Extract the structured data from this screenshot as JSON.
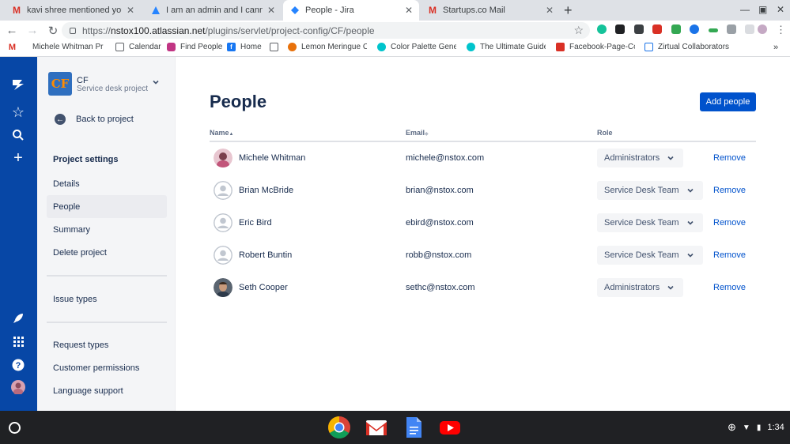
{
  "browser": {
    "tabs": [
      {
        "title": "kavi shree mentioned you in I am",
        "icon": "gmail-icon",
        "active": false
      },
      {
        "title": "I am an admin and I cannot ass",
        "icon": "atlassian-icon",
        "active": false
      },
      {
        "title": "People - Jira",
        "icon": "jira-icon",
        "active": true
      },
      {
        "title": "Startups.co Mail",
        "icon": "gmail-icon",
        "active": false
      }
    ],
    "new_tab": "+",
    "url_scheme": "https://",
    "url_host": "nstox100.atlassian.net",
    "url_path": "/plugins/servlet/project-config/CF/people",
    "bookmarks": [
      {
        "label": "Michele Whitman Pr",
        "icon": "gmail-icon"
      },
      {
        "label": "Calendar",
        "icon": "page-icon"
      },
      {
        "label": "Find People",
        "icon": "instagram-icon"
      },
      {
        "label": "Home",
        "icon": "facebook-icon"
      },
      {
        "label": "",
        "icon": "page-icon"
      },
      {
        "label": "Lemon Meringue Ch",
        "icon": "recipe-icon"
      },
      {
        "label": "Color Palette Genera",
        "icon": "canva-icon"
      },
      {
        "label": "The Ultimate Guide t",
        "icon": "canva-icon"
      },
      {
        "label": "Facebook-Page-Cove",
        "icon": "image-icon"
      },
      {
        "label": "Zirtual Collaborators",
        "icon": "grid-icon"
      }
    ],
    "more_bookmarks": "»"
  },
  "project": {
    "name": "CF",
    "type": "Service desk project",
    "avatar_text": "CF"
  },
  "sidebar": {
    "back_label": "Back to project",
    "section_title": "Project settings",
    "items": [
      {
        "label": "Details",
        "active": false
      },
      {
        "label": "People",
        "active": true
      },
      {
        "label": "Summary",
        "active": false
      },
      {
        "label": "Delete project",
        "active": false
      }
    ],
    "group2": [
      {
        "label": "Issue types"
      }
    ],
    "group3": [
      {
        "label": "Request types"
      },
      {
        "label": "Customer permissions"
      },
      {
        "label": "Language support"
      }
    ]
  },
  "page": {
    "title": "People",
    "add_button": "Add people",
    "columns": {
      "name": "Name",
      "email": "Email",
      "role": "Role"
    },
    "remove_label": "Remove",
    "people": [
      {
        "name": "Michele Whitman",
        "email": "michele@nstox.com",
        "role": "Administrators",
        "avatar": "photo"
      },
      {
        "name": "Brian McBride",
        "email": "brian@nstox.com",
        "role": "Service Desk Team",
        "avatar": "default"
      },
      {
        "name": "Eric Bird",
        "email": "ebird@nstox.com",
        "role": "Service Desk Team",
        "avatar": "default"
      },
      {
        "name": "Robert Buntin",
        "email": "robb@nstox.com",
        "role": "Service Desk Team",
        "avatar": "default"
      },
      {
        "name": "Seth Cooper",
        "email": "sethc@nstox.com",
        "role": "Administrators",
        "avatar": "photo"
      }
    ]
  },
  "system": {
    "time": "1:34"
  },
  "colors": {
    "jira_nav": "#0747a6",
    "primary_button": "#0052cc",
    "link": "#0052cc",
    "sidebar_bg": "#f4f5f7"
  }
}
